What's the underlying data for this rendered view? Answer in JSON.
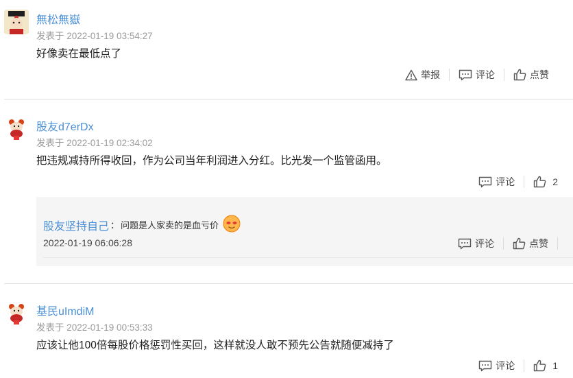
{
  "comments": [
    {
      "username": "無松無嶽",
      "meta": "发表于 2022-01-19 03:54:27",
      "content": "好像卖在最低点了",
      "report_label": "举报",
      "comment_label": "评论",
      "like_label": "点赞"
    },
    {
      "username": "股友d7erDx",
      "meta": "发表于 2022-01-19 02:34:02",
      "content": "把违规减持所得收回，作为公司当年利润进入分红。比光发一个监管函用。",
      "comment_label": "评论",
      "like_count": "2",
      "reply": {
        "username": "股友坚持自己",
        "separator": "：",
        "content": "问题是人家卖的是血亏价",
        "date": "2022-01-19 06:06:28",
        "comment_label": "评论",
        "like_label": "点赞"
      }
    },
    {
      "username": "基民uImdiM",
      "meta": "发表于 2022-01-19 00:53:33",
      "content": "应该让他100倍每股价格惩罚性买回，这样就没人敢不预先公告就随便减持了",
      "comment_label": "评论",
      "like_count": "1"
    }
  ],
  "colors": {
    "username": "#4a8fd6",
    "meta": "#9a9a9a",
    "divider": "#dedede",
    "reply_bg": "#f5f5f5"
  },
  "icons": [
    "warning-icon",
    "comment-icon",
    "thumbs-up-icon",
    "emoji-icon"
  ]
}
